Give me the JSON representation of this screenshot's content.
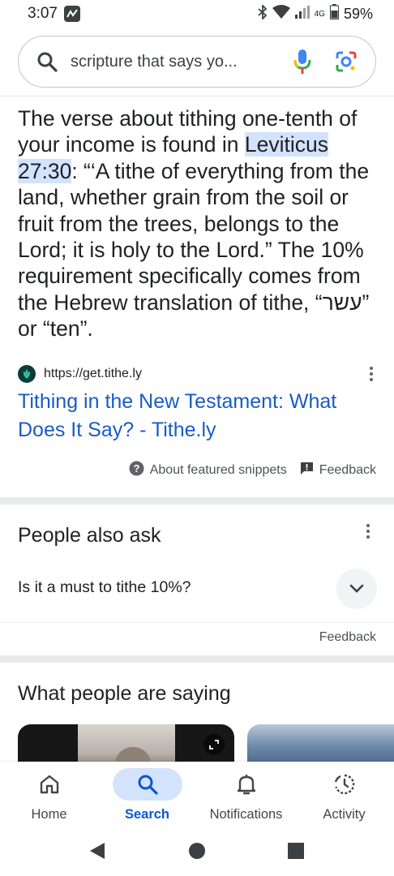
{
  "status_bar": {
    "time": "3:07",
    "network": "4G",
    "battery": "59%"
  },
  "search": {
    "query": "scripture that says yo..."
  },
  "featured_snippet": {
    "text_before": "The verse about tithing one-tenth of your income is found in ",
    "highlight": "Leviticus 27:30",
    "text_after": ": “‘A tithe of everything from the land, whether grain from the soil or fruit from the trees, belongs to the Lord; it is holy to the Lord.” The 10% requirement specifically comes from the Hebrew translation of tithe, “עשר” or “ten”.",
    "source_url": "https://get.tithe.ly",
    "result_title": "Tithing in the New Testament: What Does It Say? - Tithe.ly",
    "about_label": "About featured snippets",
    "feedback_label": "Feedback"
  },
  "people_also_ask": {
    "title": "People also ask",
    "questions": [
      "Is it a must to tithe 10%?"
    ],
    "feedback_label": "Feedback"
  },
  "what_people_are_saying": {
    "title": "What people are saying"
  },
  "bottom_nav": {
    "items": [
      {
        "label": "Home",
        "icon": "home-icon"
      },
      {
        "label": "Search",
        "icon": "search-icon"
      },
      {
        "label": "Notifications",
        "icon": "bell-icon"
      },
      {
        "label": "Activity",
        "icon": "activity-icon"
      }
    ],
    "active": "Search"
  },
  "colors": {
    "link": "#1a5bc4",
    "highlight": "#d3e3fd",
    "active_nav": "#0b57d0"
  }
}
